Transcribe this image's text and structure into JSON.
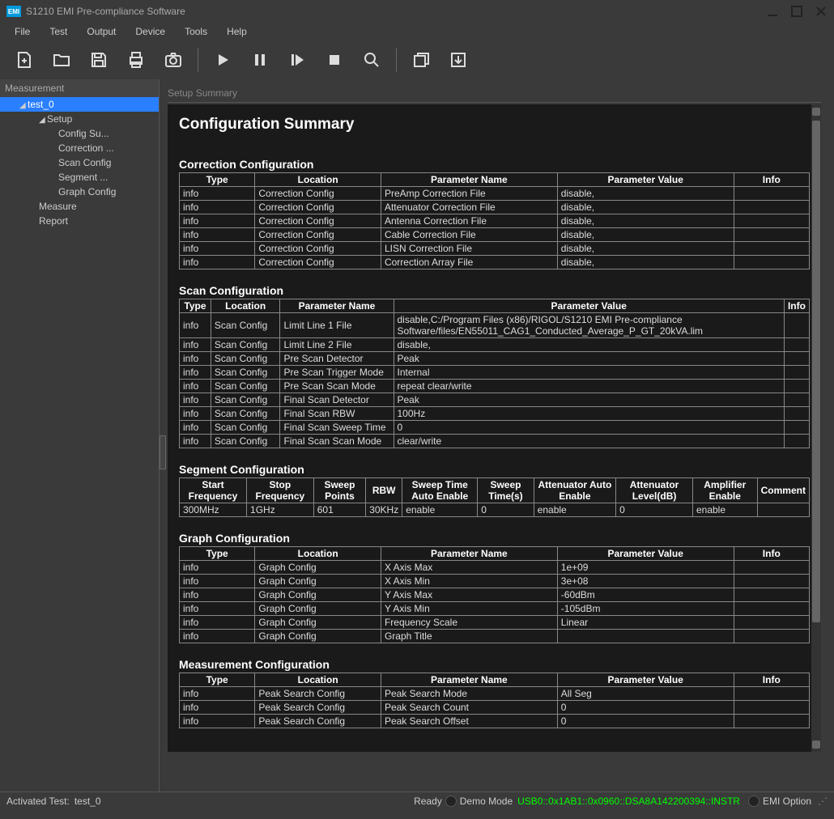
{
  "app": {
    "icon_text": "EMI",
    "title": "S1210 EMI Pre-compliance Software"
  },
  "menus": [
    "File",
    "Test",
    "Output",
    "Device",
    "Tools",
    "Help"
  ],
  "sidebar": {
    "title": "Measurement",
    "test_name": "test_0",
    "setup": "Setup",
    "config_items": [
      "Config Su...",
      "Correction ...",
      "Scan Config",
      "Segment ...",
      "Graph Config"
    ],
    "measure": "Measure",
    "report": "Report"
  },
  "panel_title": "Setup Summary",
  "heading": "Configuration Summary",
  "correction": {
    "title": "Correction Configuration",
    "headers": [
      "Type",
      "Location",
      "Parameter Name",
      "Parameter Value",
      "Info"
    ],
    "rows": [
      [
        "info",
        "Correction Config",
        "PreAmp Correction File",
        "disable,",
        ""
      ],
      [
        "info",
        "Correction Config",
        "Attenuator Correction File",
        "disable,",
        ""
      ],
      [
        "info",
        "Correction Config",
        "Antenna Correction File",
        "disable,",
        ""
      ],
      [
        "info",
        "Correction Config",
        "Cable Correction File",
        "disable,",
        ""
      ],
      [
        "info",
        "Correction Config",
        "LISN Correction File",
        "disable,",
        ""
      ],
      [
        "info",
        "Correction Config",
        "Correction Array File",
        "disable,",
        ""
      ]
    ]
  },
  "scan": {
    "title": "Scan Configuration",
    "headers": [
      "Type",
      "Location",
      "Parameter Name",
      "Parameter Value",
      "Info"
    ],
    "rows": [
      [
        "info",
        "Scan Config",
        "Limit Line 1 File",
        "disable,C:/Program Files (x86)/RIGOL/S1210 EMI Pre-compliance Software/files/EN55011_CAG1_Conducted_Average_P_GT_20kVA.lim",
        ""
      ],
      [
        "info",
        "Scan Config",
        "Limit Line 2 File",
        "disable,",
        ""
      ],
      [
        "info",
        "Scan Config",
        "Pre Scan Detector",
        "Peak",
        ""
      ],
      [
        "info",
        "Scan Config",
        "Pre Scan Trigger Mode",
        "Internal",
        ""
      ],
      [
        "info",
        "Scan Config",
        "Pre Scan Scan Mode",
        "repeat clear/write",
        ""
      ],
      [
        "info",
        "Scan Config",
        "Final Scan Detector",
        "Peak",
        ""
      ],
      [
        "info",
        "Scan Config",
        "Final Scan RBW",
        "100Hz",
        ""
      ],
      [
        "info",
        "Scan Config",
        "Final Scan Sweep Time",
        "0",
        ""
      ],
      [
        "info",
        "Scan Config",
        "Final Scan Scan Mode",
        "clear/write",
        ""
      ]
    ]
  },
  "segment": {
    "title": "Segment Configuration",
    "headers": [
      "Start Frequency",
      "Stop Frequency",
      "Sweep Points",
      "RBW",
      "Sweep Time Auto Enable",
      "Sweep Time(s)",
      "Attenuator Auto Enable",
      "Attenuator Level(dB)",
      "Amplifier Enable",
      "Comment"
    ],
    "rows": [
      [
        "300MHz",
        "1GHz",
        "601",
        "30KHz",
        "enable",
        "0",
        "enable",
        "0",
        "enable",
        ""
      ]
    ]
  },
  "graph": {
    "title": "Graph Configuration",
    "headers": [
      "Type",
      "Location",
      "Parameter Name",
      "Parameter Value",
      "Info"
    ],
    "rows": [
      [
        "info",
        "Graph Config",
        "X Axis Max",
        "1e+09",
        ""
      ],
      [
        "info",
        "Graph Config",
        "X Axis Min",
        "3e+08",
        ""
      ],
      [
        "info",
        "Graph Config",
        "Y Axis Max",
        "-60dBm",
        ""
      ],
      [
        "info",
        "Graph Config",
        "Y Axis Min",
        "-105dBm",
        ""
      ],
      [
        "info",
        "Graph Config",
        "Frequency Scale",
        "Linear",
        ""
      ],
      [
        "info",
        "Graph Config",
        "Graph Title",
        "",
        ""
      ]
    ]
  },
  "measurement": {
    "title": "Measurement Configuration",
    "headers": [
      "Type",
      "Location",
      "Parameter Name",
      "Parameter Value",
      "Info"
    ],
    "rows": [
      [
        "info",
        "Peak Search Config",
        "Peak Search Mode",
        "All Seg",
        ""
      ],
      [
        "info",
        "Peak Search Config",
        "Peak Search Count",
        "0",
        ""
      ],
      [
        "info",
        "Peak Search Config",
        "Peak Search Offset",
        "0",
        ""
      ]
    ]
  },
  "status": {
    "activated_label": "Activated Test:",
    "activated_value": "test_0",
    "ready": "Ready",
    "demo": "Demo Mode",
    "instr": "USB0::0x1AB1::0x0960::DSA8A142200394::INSTR",
    "emi_option": "EMI Option"
  }
}
